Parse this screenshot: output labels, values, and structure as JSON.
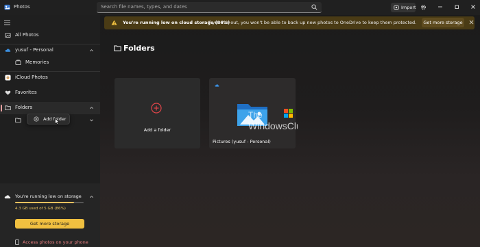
{
  "app": {
    "title": "Photos"
  },
  "search": {
    "placeholder": "Search file names, types, and dates"
  },
  "toolbar": {
    "import_label": "Import"
  },
  "sidebar": {
    "items": [
      {
        "label": "All Photos"
      },
      {
        "label": "yusuf - Personal"
      },
      {
        "label": "Memories"
      },
      {
        "label": "iCloud Photos"
      },
      {
        "label": "Favorites"
      },
      {
        "label": "Folders"
      }
    ],
    "tooltip_label": "Add folder"
  },
  "storage": {
    "title": "You're running low on storage",
    "detail": "4.3 GB used of 5 GB (86%)",
    "used_fraction": 0.86,
    "button_label": "Get more storage",
    "phone_link": "Access photos on your phone"
  },
  "banner": {
    "bold": "You're running low on cloud storage (86%)",
    "message": "If you run out, you won't be able to back up new photos to OneDrive to keep them protected.",
    "button_label": "Get more storage"
  },
  "main": {
    "heading": "Folders",
    "tiles": [
      {
        "label": "Add a folder"
      },
      {
        "label": "Pictures (yusuf - Personal)"
      }
    ]
  },
  "colors": {
    "accent": "#f0c040",
    "warning_bg": "#4a3b15",
    "link": "#e87f80"
  },
  "icons": [
    "search-icon",
    "gear-icon",
    "import-icon",
    "cloud-icon",
    "folder-icon",
    "heart-icon",
    "plus-icon",
    "warning-icon",
    "close-icon",
    "phone-icon"
  ]
}
